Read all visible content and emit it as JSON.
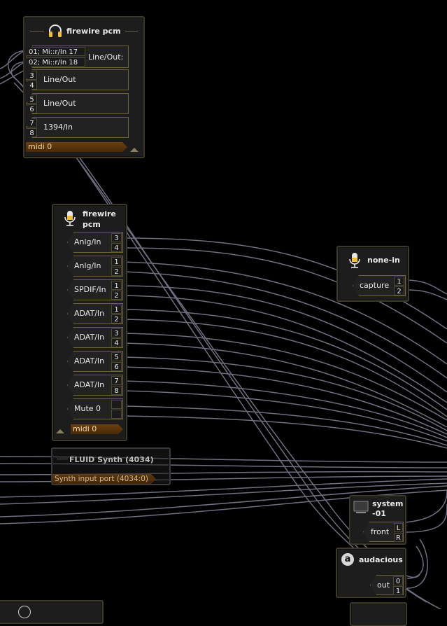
{
  "colors": {
    "wire": "#6f6f80",
    "node_border": "#3d3a2a",
    "port_border": "#6e6438",
    "midi_bg": "#5a3510"
  },
  "playback_node": {
    "title": "firewire pcm",
    "icon": "headphones-icon",
    "ports": [
      {
        "label": "Line/Out:",
        "channels": [
          "01; Mi::r/In 17",
          "02; Mi::r/In 18"
        ]
      },
      {
        "label": "Line/Out",
        "channels": [
          "3",
          "4"
        ]
      },
      {
        "label": "Line/Out",
        "channels": [
          "5",
          "6"
        ]
      },
      {
        "label": "1394/In",
        "channels": [
          "7",
          "8"
        ]
      }
    ],
    "midi": "midi 0"
  },
  "capture_node": {
    "title_line1": "firewire",
    "title_line2": "pcm",
    "icon": "microphone-icon",
    "ports": [
      {
        "label": "Anlg/In",
        "channels": [
          "3",
          "4"
        ]
      },
      {
        "label": "Anlg/In",
        "channels": [
          "1",
          "2"
        ]
      },
      {
        "label": "SPDIF/In",
        "channels": [
          "1",
          "2"
        ]
      },
      {
        "label": "ADAT/In",
        "channels": [
          "1",
          "2"
        ]
      },
      {
        "label": "ADAT/In",
        "channels": [
          "3",
          "4"
        ]
      },
      {
        "label": "ADAT/In",
        "channels": [
          "5",
          "6"
        ]
      },
      {
        "label": "ADAT/In",
        "channels": [
          "7",
          "8"
        ]
      },
      {
        "label": "Mute 0",
        "channels": [
          "",
          ""
        ]
      }
    ],
    "midi": "midi 0"
  },
  "none_in_node": {
    "title": "none-in",
    "icon": "microphone-icon",
    "port": {
      "label": "capture",
      "channels": [
        "1",
        "2"
      ]
    }
  },
  "fluid_node": {
    "title": "FLUID Synth (4034)",
    "port": "Synth input port (4034:0)"
  },
  "system_node": {
    "title_line1": "system",
    "title_line2": "-01",
    "icon": "monitor-icon",
    "port": {
      "label": "front",
      "channels": [
        "L",
        "R"
      ]
    }
  },
  "audacious_node": {
    "title": "audacious",
    "icon": "audacious-app-icon",
    "icon_letter": "a",
    "port": {
      "label": "out",
      "channels": [
        "0",
        "1"
      ]
    }
  }
}
